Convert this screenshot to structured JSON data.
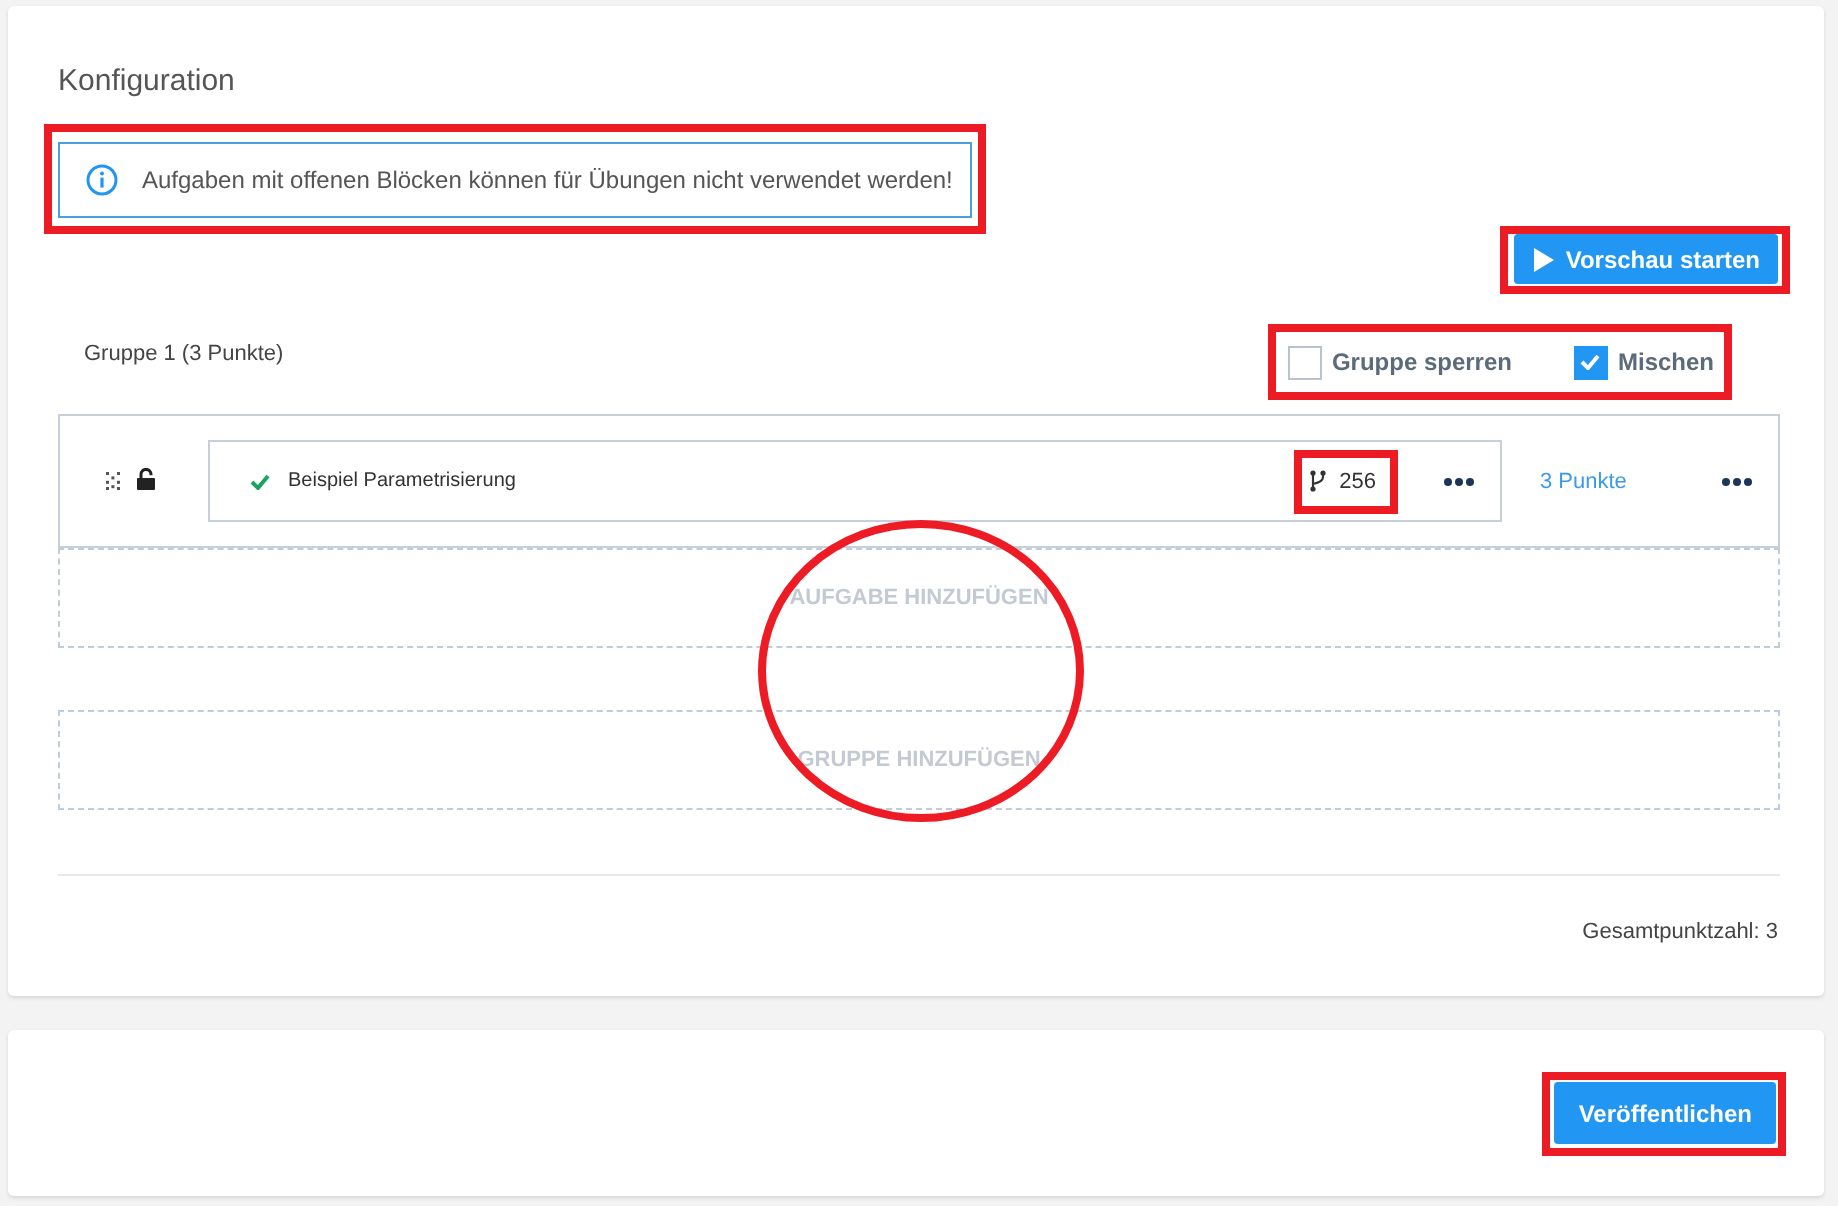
{
  "section": {
    "title": "Konfiguration"
  },
  "info": {
    "text": "Aufgaben mit offenen Blöcken können für Übungen nicht verwendet werden!",
    "highlighted": true
  },
  "preview_button": {
    "label": "Vorschau starten",
    "highlighted": true
  },
  "group": {
    "label": "Gruppe 1 (3 Punkte)",
    "options": [
      {
        "label": "Gruppe sperren",
        "checked": false
      },
      {
        "label": "Mischen",
        "checked": true
      }
    ],
    "options_highlighted": true,
    "tasks": [
      {
        "title": "Beispiel Parametrisierung",
        "done": true,
        "locked": false,
        "variants": "256",
        "variants_highlighted": true,
        "points": "3 Punkte"
      }
    ]
  },
  "add_actions": {
    "items": [
      {
        "label": "AUFGABE HINZUFÜGEN"
      },
      {
        "label": "GRUPPE HINZUFÜGEN"
      }
    ],
    "circled": true
  },
  "total": "Gesamtpunktzahl: 3",
  "publish_button": {
    "label": "Veröffentlichen",
    "highlighted": true
  }
}
